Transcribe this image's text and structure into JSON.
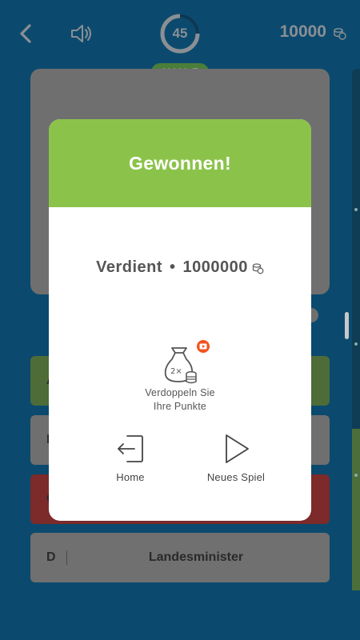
{
  "topbar": {
    "timer_value": "45",
    "prize_value": "20000",
    "score_value": "10000"
  },
  "answers": [
    {
      "letter": "A",
      "text": ""
    },
    {
      "letter": "B",
      "text": ""
    },
    {
      "letter": "C",
      "text": ""
    },
    {
      "letter": "D",
      "text": "Landesminister"
    }
  ],
  "dialog": {
    "title": "Gewonnen!",
    "earned_label": "Verdient",
    "earned_sep": "•",
    "earned_value": "1000000",
    "double_line1": "Verdoppeln Sie",
    "double_line2": "Ihre Punkte",
    "double_badge": "2×",
    "home_label": "Home",
    "new_game_label": "Neues Spiel"
  },
  "colors": {
    "background": "#0b4a6e",
    "header_green": "#8bc34a",
    "video_badge": "#f4511e"
  },
  "icons": [
    "back-arrow-icon",
    "speaker-icon",
    "timer-ring-icon",
    "coin-stack-icon",
    "money-bag-icon",
    "video-play-icon",
    "exit-door-icon",
    "play-triangle-icon"
  ]
}
